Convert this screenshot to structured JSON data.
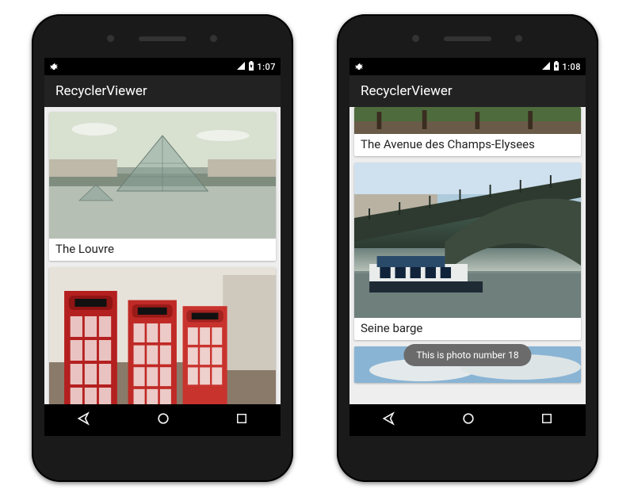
{
  "app_title": "RecyclerViewer",
  "phones": {
    "left": {
      "status": {
        "time": "1:07"
      },
      "cards": [
        {
          "caption": "The Louvre"
        }
      ]
    },
    "right": {
      "status": {
        "time": "1:08"
      },
      "cards": [
        {
          "caption": "The Avenue des Champs-Elysees"
        },
        {
          "caption": "Seine barge"
        }
      ],
      "toast": "This is photo number 18"
    }
  }
}
